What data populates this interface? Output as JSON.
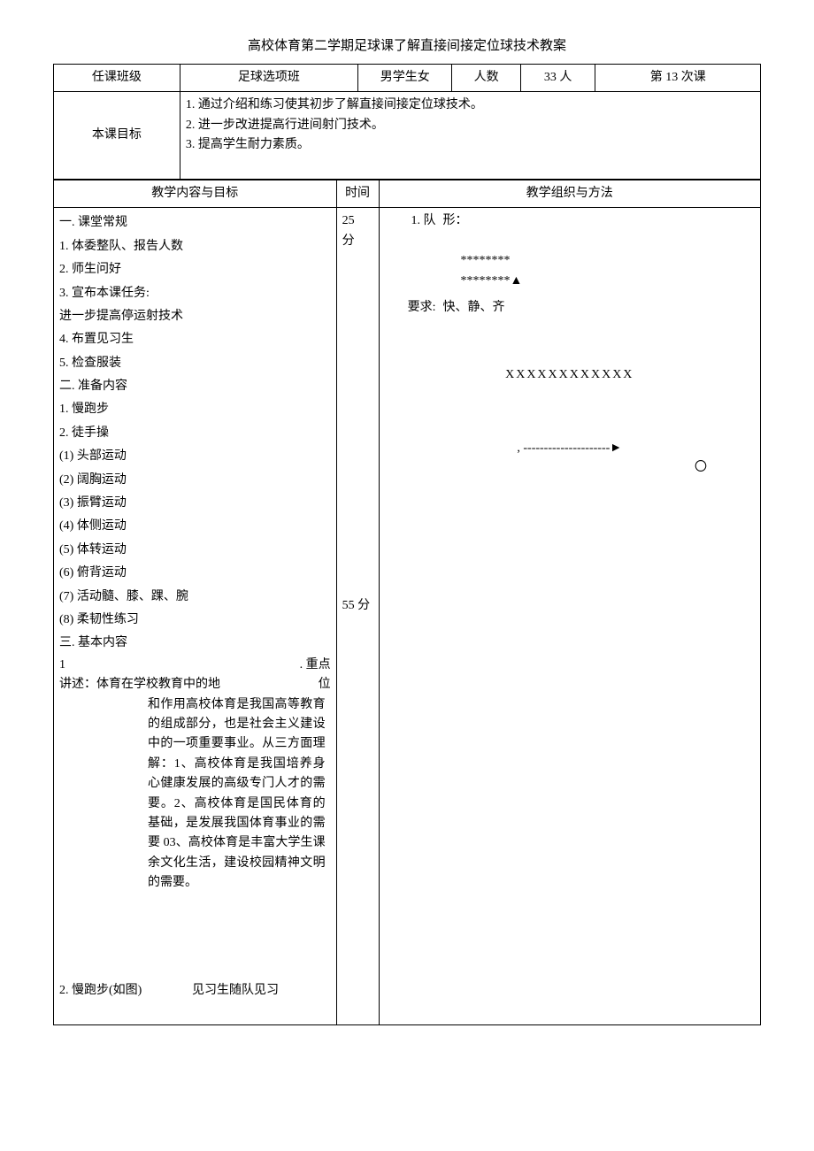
{
  "title": "高校体育第二学期足球课了解直接间接定位球技术教案",
  "header": {
    "class_label": "任课班级",
    "class_value": "足球选项班",
    "student_type": "男学生女",
    "count_label": "人数",
    "count_value": "33 人",
    "lesson_no": "第 13 次课"
  },
  "objectives": {
    "label": "本课目标",
    "items": [
      "1. 通过介绍和练习使其初步了解直接间接定位球技术。",
      "2. 进一步改进提高行进间射门技术。",
      "3. 提高学生耐力素质。"
    ]
  },
  "columns": {
    "content": "教学内容与目标",
    "time": "时间",
    "org": "教学组织与方法"
  },
  "body": {
    "section1": {
      "h": "一. 课堂常规",
      "i1": "1. 体委整队、报告人数",
      "i2": "2. 师生问好",
      "i3": "3. 宣布本课任务:",
      "i3sub": "进一步提高停运射技术",
      "i4": "4. 布置见习生",
      "i5": "5. 检查服装"
    },
    "section2": {
      "h": "二. 准备内容",
      "i1": "1. 慢跑步",
      "i2": "2. 徒手操",
      "ex": [
        "(1) 头部运动",
        "(2) 阔胸运动",
        "(3) 振臂运动",
        "(4) 体侧运动",
        "(5) 体转运动",
        "(6) 俯背运动",
        "(7) 活动髓、膝、踝、腕",
        "(8) 柔韧性练习"
      ]
    },
    "section3": {
      "h": "三. 基本内容",
      "i1a": "1",
      "i1b": ". 重点",
      "i1c": "讲述：体育在学校教育中的地",
      "i1d": "位",
      "desc": "和作用高校体育是我国高等教育的组成部分，也是社会主义建设中的一项重要事业。从三方面理解：1、高校体育是我国培养身心健康发展的高级专门人才的需要。2、高校体育是国民体育的基础，是发展我国体育事业的需要 03、高校体育是丰富大学生课余文化生活，建设校园精神文明的需要。",
      "i2a": "2. 慢跑步(如图)",
      "i2b": "见习生随队见习"
    },
    "time1": "25",
    "time1unit": "分",
    "time2": "55 分",
    "org": {
      "f_label": "1. 队",
      "f_text": "形：",
      "stars1": "********",
      "stars2": "********▲",
      "req_label": "要求:",
      "req_text": "快、静、齐",
      "x_line": "XXXXXXXXXXXX",
      "dash": "---------------------►",
      "circle": "〇"
    }
  }
}
